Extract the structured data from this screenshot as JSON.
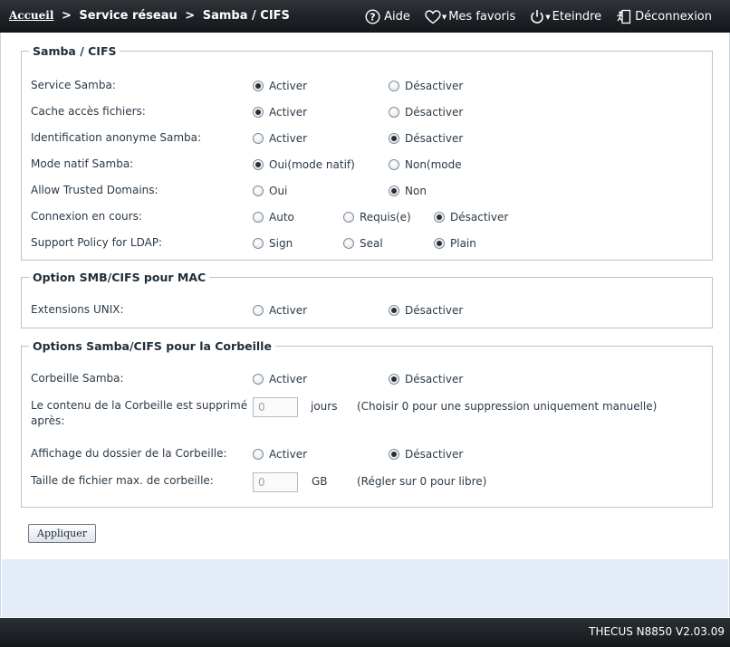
{
  "header": {
    "breadcrumb": {
      "home": "Accueil",
      "sep1": ">",
      "level1": "Service réseau",
      "sep2": ">",
      "level2": "Samba / CIFS"
    },
    "toolbar": {
      "help": "Aide",
      "favorites": "Mes favoris",
      "shutdown": "Eteindre",
      "logout": "Déconnexion"
    }
  },
  "sections": {
    "samba": {
      "legend": "Samba / CIFS",
      "service": {
        "label": "Service Samba:",
        "on": "Activer",
        "off": "Désactiver",
        "selected": "on"
      },
      "cache": {
        "label": "Cache accès fichiers:",
        "on": "Activer",
        "off": "Désactiver",
        "selected": "on"
      },
      "anonymous": {
        "label": "Identification anonyme Samba:",
        "on": "Activer",
        "off": "Désactiver",
        "selected": "off"
      },
      "native": {
        "label": "Mode natif Samba:",
        "on": "Oui(mode natif)",
        "off": "Non(mode",
        "selected": "on"
      },
      "trusted": {
        "label": "Allow Trusted Domains:",
        "on": "Oui",
        "off": "Non",
        "selected": "off"
      },
      "connection": {
        "label": "Connexion en cours:",
        "opt1": "Auto",
        "opt2": "Requis(e)",
        "opt3": "Désactiver",
        "selected": "opt3"
      },
      "ldap": {
        "label": "Support Policy for LDAP:",
        "opt1": "Sign",
        "opt2": "Seal",
        "opt3": "Plain",
        "selected": "opt3"
      }
    },
    "mac": {
      "legend": "Option SMB/CIFS pour MAC",
      "unix": {
        "label": "Extensions UNIX:",
        "on": "Activer",
        "off": "Désactiver",
        "selected": "off"
      }
    },
    "recycle": {
      "legend": "Options Samba/CIFS pour la Corbeille",
      "bin": {
        "label": "Corbeille Samba:",
        "on": "Activer",
        "off": "Désactiver",
        "selected": "off"
      },
      "retention": {
        "label_line1": "Le contenu de la Corbeille est supprimé",
        "label_line2": "après:",
        "value": "0",
        "unit": "jours",
        "hint": "(Choisir 0 pour une suppression uniquement manuelle)"
      },
      "display": {
        "label": "Affichage du dossier de la Corbeille:",
        "on": "Activer",
        "off": "Désactiver",
        "selected": "off"
      },
      "maxsize": {
        "label": "Taille de fichier max. de corbeille:",
        "value": "0",
        "unit": "GB",
        "hint": "(Régler sur 0 pour libre)"
      }
    }
  },
  "actions": {
    "apply": "Appliquer"
  },
  "footer": {
    "version": "THECUS N8850 V2.03.09"
  },
  "colors": {
    "topbar": "#1d2126",
    "panel_bottom": "#e4ecf7",
    "text": "#2b3a47"
  }
}
